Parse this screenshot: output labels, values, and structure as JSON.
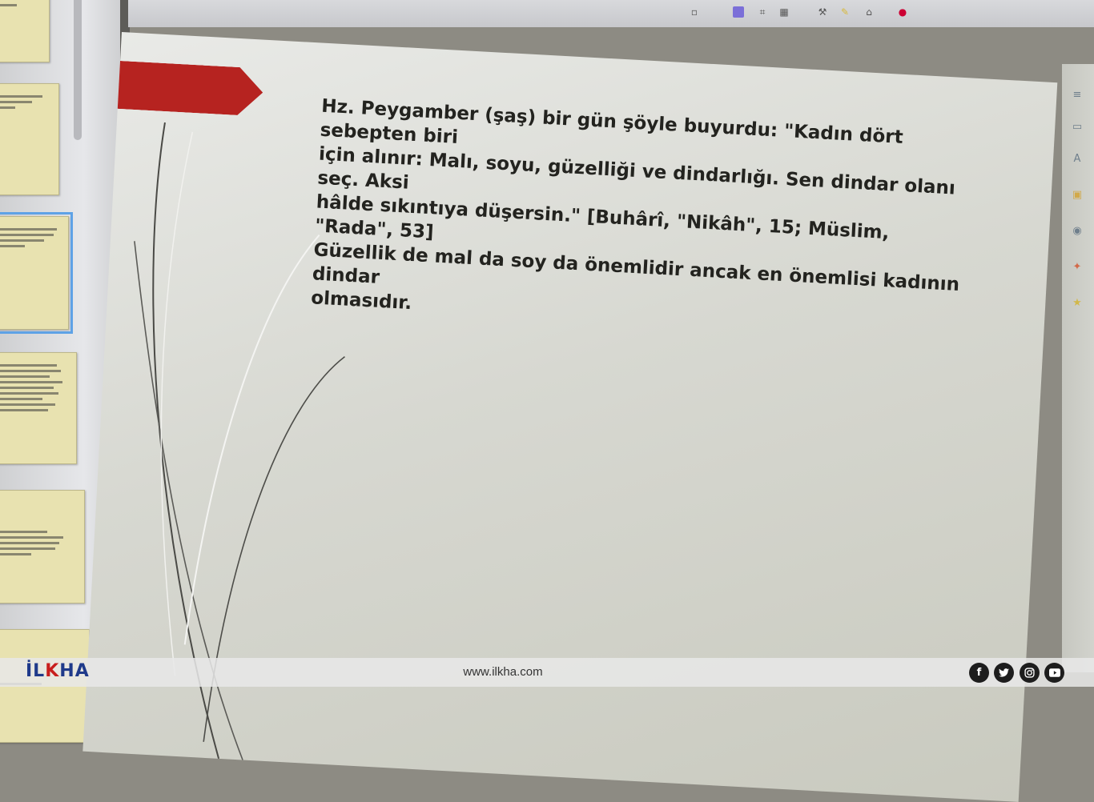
{
  "slide": {
    "bullet_icon": "",
    "lines": [
      "Hz. Peygamber (şaş) bir gün şöyle buyurdu: \"Kadın dört sebepten biri",
      "için alınır: Malı, soyu, güzelliği ve dindarlığı. Sen dindar olanı seç. Aksi",
      "hâlde sıkıntıya düşersin.\" [Buhârî, \"Nikâh\", 15; Müslim, \"Rada\", 53]",
      "Güzellik de mal da soy da önemlidir ancak en önemlisi kadının dindar",
      "olmasıdır."
    ]
  },
  "thumbnails": {
    "visible_number": "3"
  },
  "watermark": {
    "logo_main": "İL",
    "logo_k": "K",
    "logo_end": "HA",
    "url": "www.ilkha.com",
    "social": [
      "f",
      "t",
      "ig",
      "yt"
    ]
  },
  "colors": {
    "ribbon": "#b62320",
    "slide_background": "#d7d8d1",
    "thumbnail_background": "#e8e2b0",
    "selection": "#5ea2e6",
    "logo_blue": "#1f3a8a",
    "logo_red": "#c81e1e"
  }
}
